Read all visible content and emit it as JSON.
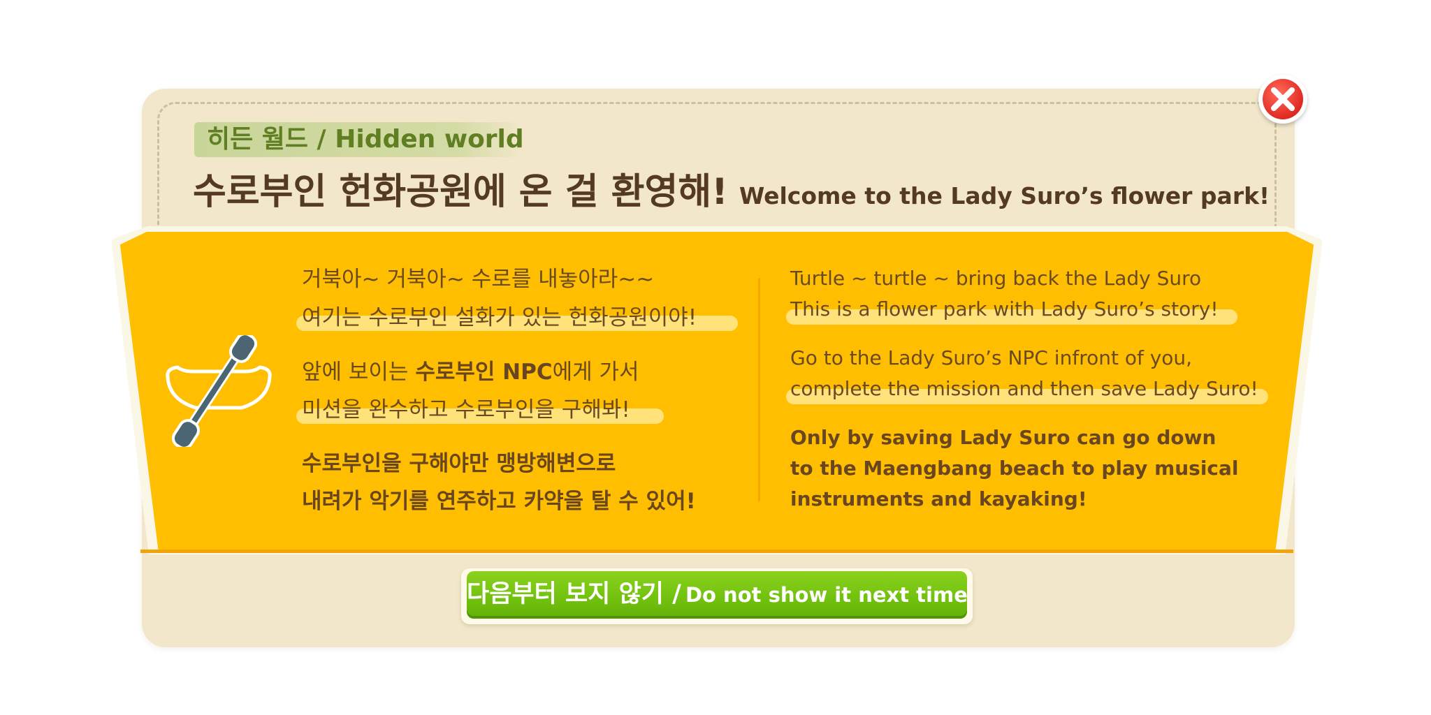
{
  "colors": {
    "panel": "#f2e7cb",
    "card": "#ffbf00",
    "text_brown": "#553a22",
    "subtitle_green": "#5f7f22",
    "button_green": "#71c00e",
    "close_red": "#e02a22"
  },
  "header": {
    "subtitle": "히든 월드 / Hidden world",
    "title_ko": "수로부인 헌화공원에 온 걸 환영해!",
    "title_en": "Welcome to the Lady Suro’s flower park!"
  },
  "close_button": {
    "icon": "close-icon"
  },
  "card": {
    "icon": "kayak-paddle-icon",
    "korean": {
      "line1": "거북아~ 거북아~ 수로를 내놓아라~~",
      "line2": "여기는 수로부인 설화가 있는 헌화공원이야!",
      "line3_prefix": "앞에 보이는 ",
      "line3_bold": "수로부인 NPC",
      "line3_suffix": "에게 가서",
      "line4": "미션을 완수하고 수로부인을 구해봐!",
      "line5": "수로부인을 구해야만 맹방해변으로",
      "line6": "내려가 악기를 연주하고 카약을 탈 수 있어!"
    },
    "english": {
      "line1": "Turtle ~ turtle ~ bring back the Lady Suro",
      "line2": "This is a flower park with Lady Suro’s story!",
      "line3": "Go to the Lady Suro’s NPC infront of you,",
      "line4": "complete the mission and then save Lady Suro!",
      "line5": "Only by saving Lady Suro can go down",
      "line6": "to the Maengbang beach to play musical",
      "line7": "instruments and kayaking!"
    }
  },
  "footer": {
    "button_ko": "다음부터 보지 않기 /",
    "button_en": "Do not show it next time"
  }
}
